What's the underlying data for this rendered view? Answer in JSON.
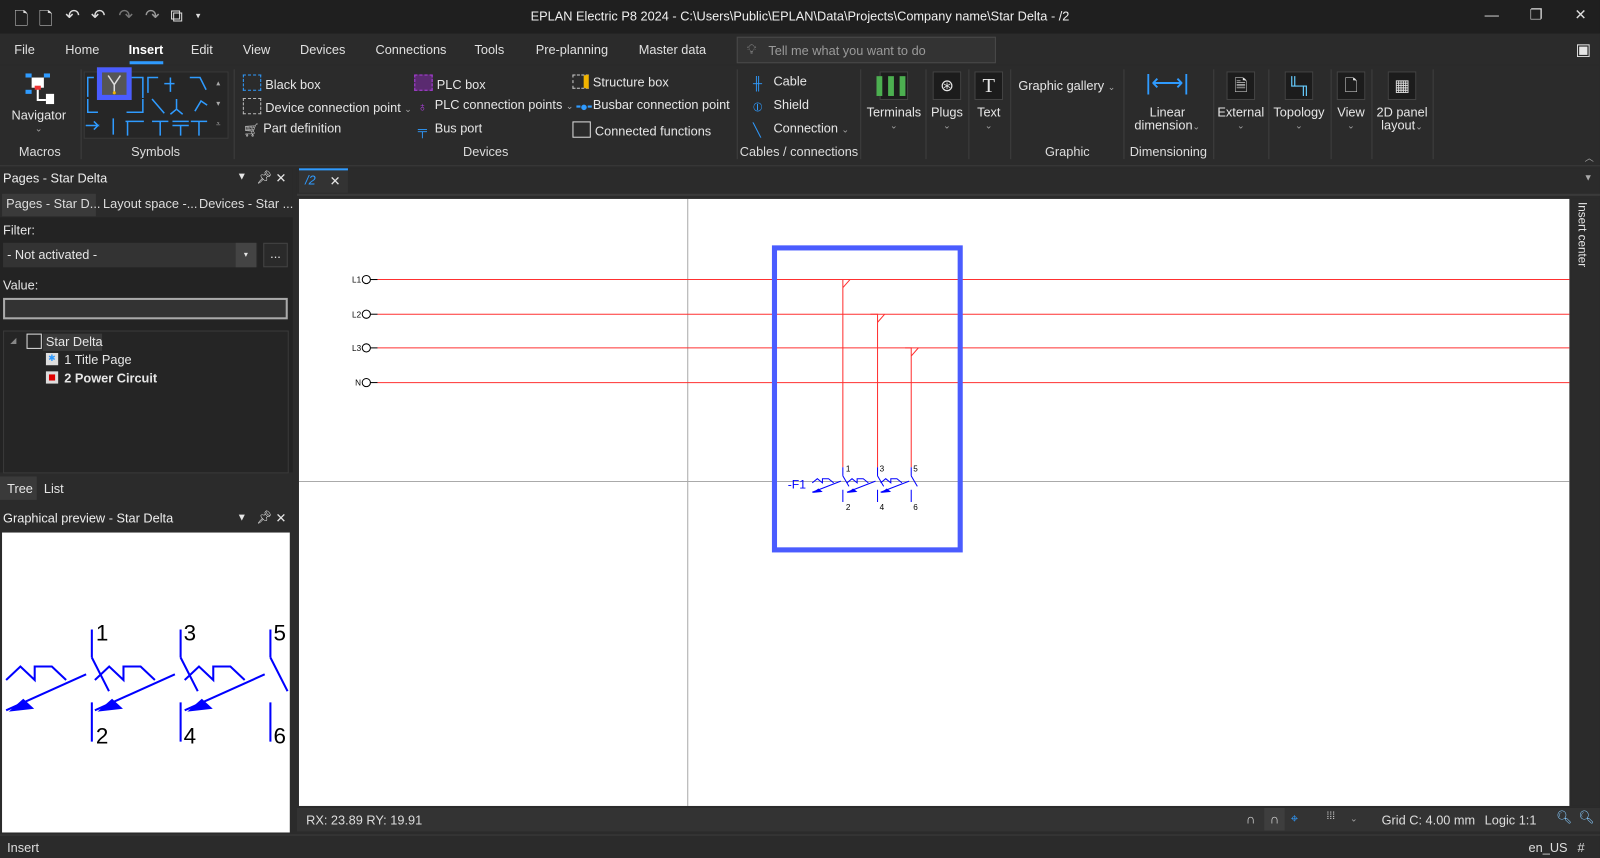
{
  "app": {
    "title": "EPLAN Electric P8 2024 - C:\\Users\\Public\\EPLAN\\Data\\Projects\\Company name\\Star Delta - /2"
  },
  "menu": [
    "File",
    "Home",
    "Insert",
    "Edit",
    "View",
    "Devices",
    "Connections",
    "Tools",
    "Pre-planning",
    "Master data"
  ],
  "search": {
    "placeholder": "Tell me what you want to do"
  },
  "ribbon": {
    "macros": {
      "navigator": "Navigator",
      "group": "Macros"
    },
    "symbols": {
      "group": "Symbols"
    },
    "devices": {
      "group": "Devices",
      "items": [
        "Black box",
        "Device connection point",
        "Part definition",
        "PLC box",
        "PLC connection points",
        "Bus port",
        "Structure box",
        "Busbar connection point",
        "Connected functions"
      ]
    },
    "cables": {
      "group": "Cables / connections",
      "items": [
        "Cable",
        "Shield",
        "Connection"
      ]
    },
    "terminals": "Terminals",
    "plugs": "Plugs",
    "text": "Text",
    "graphic": {
      "gallery": "Graphic gallery",
      "group": "Graphic"
    },
    "dimensioning": {
      "line1": "Linear",
      "line2": "dimension",
      "group": "Dimensioning"
    },
    "external": "External",
    "topology": "Topology",
    "view": "View",
    "panel2d": {
      "line1": "2D panel",
      "line2": "layout"
    }
  },
  "pages_panel": {
    "title": "Pages - Star Delta",
    "tabs": [
      "Pages - Star D...",
      "Layout space -...",
      "Devices - Star ..."
    ],
    "filter_label": "Filter:",
    "filter_value": "- Not activated -",
    "more_button": "...",
    "value_label": "Value:",
    "value": "",
    "tree": {
      "root": "Star Delta",
      "pages": [
        "1 Title Page",
        "2 Power Circuit"
      ]
    },
    "bottom_tabs": [
      "Tree",
      "List"
    ]
  },
  "preview_panel": {
    "title": "Graphical preview - Star Delta",
    "labels": [
      "1",
      "3",
      "5",
      "2",
      "4",
      "6"
    ]
  },
  "document": {
    "tab": "/2",
    "side_panel": "Insert center",
    "schematic": {
      "lines": [
        "L1",
        "L2",
        "L3",
        "N"
      ],
      "device": "-F1",
      "terminals": [
        "1",
        "3",
        "5",
        "2",
        "4",
        "6"
      ]
    }
  },
  "statusbar": {
    "coords": "RX: 23.89 RY: 19.91",
    "grid": "Grid C: 4.00 mm",
    "logic": "Logic 1:1"
  },
  "bottombar": {
    "mode": "Insert",
    "locale": "en_US",
    "hash": "#"
  },
  "colors": {
    "accent": "#2f9bff",
    "selection": "#4a5cff",
    "wire": "#ff3030",
    "symbol": "#1010ff"
  }
}
